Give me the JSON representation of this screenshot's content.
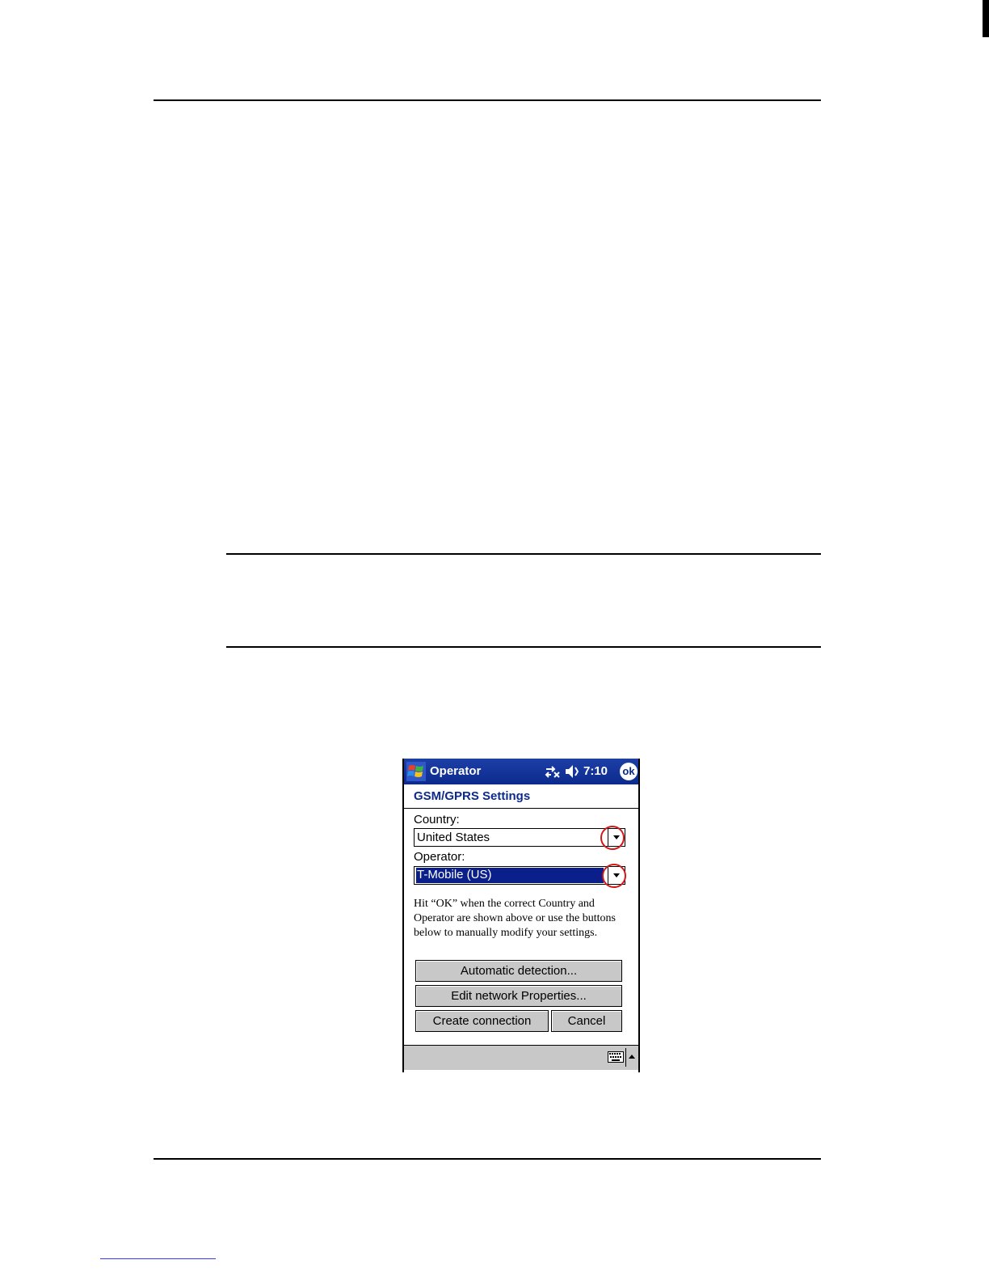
{
  "device": {
    "title_bar": {
      "app_title": "Operator",
      "time": "7:10",
      "ok_label": "ok"
    },
    "heading": "GSM/GPRS Settings",
    "country": {
      "label": "Country:",
      "value": "United States"
    },
    "operator": {
      "label": "Operator:",
      "value": "T-Mobile (US)"
    },
    "instructions": "Hit “OK” when the correct Country and Operator are shown above or use the buttons below to manually modify your settings.",
    "buttons": {
      "automatic_detection": "Automatic detection...",
      "edit_network": "Edit network Properties...",
      "create_connection": "Create connection",
      "cancel": "Cancel"
    },
    "icons": {
      "start": "windows-flag-icon",
      "connectivity": "connectivity-icon",
      "volume": "speaker-muted-icon",
      "keyboard": "keyboard-icon",
      "sip": "input-panel-arrow-icon"
    },
    "colors": {
      "title_bar": "#0c2a8e",
      "selection": "#0a1f8a",
      "highlight_circle": "#d01818"
    }
  }
}
